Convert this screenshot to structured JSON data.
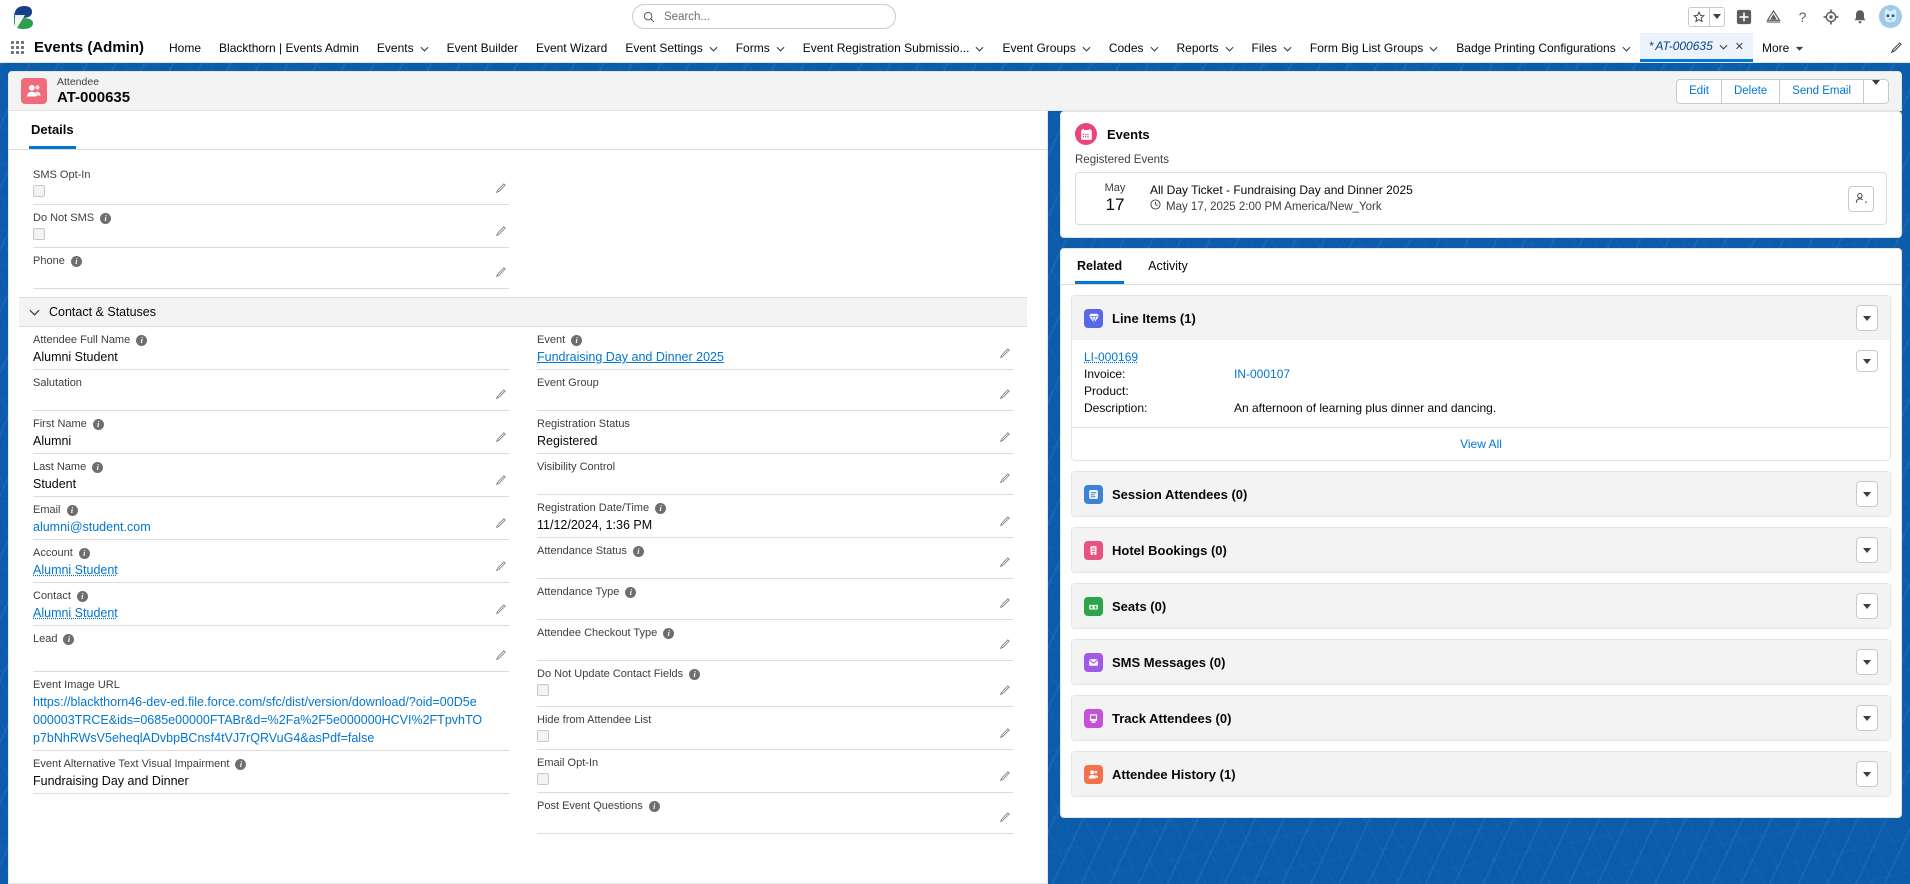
{
  "global_header": {
    "search_placeholder": "Search...",
    "search_value": "",
    "icons": [
      "favorites-star-icon",
      "favorites-caret-icon",
      "add-icon",
      "learning-icon",
      "help-icon",
      "setup-gear-icon",
      "notifications-bell-icon",
      "user-avatar"
    ]
  },
  "app_nav": {
    "app_name": "Events (Admin)",
    "items": [
      {
        "label": "Home",
        "caret": false,
        "active": false
      },
      {
        "label": "Blackthorn | Events Admin",
        "caret": false,
        "active": false
      },
      {
        "label": "Events",
        "caret": true,
        "active": false
      },
      {
        "label": "Event Builder",
        "caret": false,
        "active": false
      },
      {
        "label": "Event Wizard",
        "caret": false,
        "active": false
      },
      {
        "label": "Event Settings",
        "caret": true,
        "active": false
      },
      {
        "label": "Forms",
        "caret": true,
        "active": false
      },
      {
        "label": "Event Registration Submissio...",
        "caret": true,
        "active": false
      },
      {
        "label": "Event Groups",
        "caret": true,
        "active": false
      },
      {
        "label": "Codes",
        "caret": true,
        "active": false
      },
      {
        "label": "Reports",
        "caret": true,
        "active": false
      },
      {
        "label": "Files",
        "caret": true,
        "active": false
      },
      {
        "label": "Form Big List Groups",
        "caret": true,
        "active": false
      },
      {
        "label": "Badge Printing Configurations",
        "caret": true,
        "active": false
      }
    ],
    "active_tab": {
      "prefix": "*",
      "label": "AT-000635",
      "close": "✕"
    },
    "more_label": "More"
  },
  "record_header": {
    "object_label": "Attendee",
    "record_name": "AT-000635",
    "buttons": [
      "Edit",
      "Delete",
      "Send Email"
    ]
  },
  "details": {
    "tab_label": "Details",
    "top_fields": [
      {
        "label": "SMS Opt-In",
        "info": false,
        "type": "checkbox",
        "value": "",
        "editable": true
      },
      {
        "label": "Do Not SMS",
        "info": true,
        "type": "checkbox",
        "value": "",
        "editable": true
      },
      {
        "label": "Phone",
        "info": true,
        "type": "text",
        "value": "",
        "editable": true
      }
    ],
    "section_title": "Contact & Statuses",
    "left_fields": [
      {
        "label": "Attendee Full Name",
        "info": true,
        "type": "text",
        "value": "Alumni Student",
        "editable": false
      },
      {
        "label": "Salutation",
        "info": false,
        "type": "text",
        "value": "",
        "editable": true
      },
      {
        "label": "First Name",
        "info": true,
        "type": "text",
        "value": "Alumni",
        "editable": true
      },
      {
        "label": "Last Name",
        "info": true,
        "type": "text",
        "value": "Student",
        "editable": true
      },
      {
        "label": "Email",
        "info": true,
        "type": "link-plain",
        "value": "alumni@student.com",
        "editable": true
      },
      {
        "label": "Account",
        "info": true,
        "type": "link-dotted",
        "value": "Alumni Student",
        "editable": true
      },
      {
        "label": "Contact",
        "info": true,
        "type": "link-dotted",
        "value": "Alumni Student",
        "editable": true
      },
      {
        "label": "Lead",
        "info": true,
        "type": "text",
        "value": "",
        "editable": true
      },
      {
        "label": "Event Image URL",
        "info": false,
        "type": "link-url",
        "value": "https://blackthorn46-dev-ed.file.force.com/sfc/dist/version/download/?oid=00D5e000003TRCE&ids=0685e00000FTABr&d=%2Fa%2F5e000000HCVI%2FTpvhTOp7bNhRWsV5eheqlADvbpBCnsf4tVJ7rQRVuG4&asPdf=false",
        "editable": false
      },
      {
        "label": "Event Alternative Text Visual Impairment",
        "info": true,
        "type": "text",
        "value": "Fundraising Day and Dinner",
        "editable": false
      }
    ],
    "right_fields": [
      {
        "label": "Event",
        "info": true,
        "type": "link-dotted",
        "value": "Fundraising Day and Dinner 2025",
        "editable": true
      },
      {
        "label": "Event Group",
        "info": false,
        "type": "text",
        "value": "",
        "editable": true
      },
      {
        "label": "Registration Status",
        "info": false,
        "type": "text",
        "value": "Registered",
        "editable": true
      },
      {
        "label": "Visibility Control",
        "info": false,
        "type": "text",
        "value": "",
        "editable": true
      },
      {
        "label": "Registration Date/Time",
        "info": true,
        "type": "text",
        "value": "11/12/2024, 1:36 PM",
        "editable": true
      },
      {
        "label": "Attendance Status",
        "info": true,
        "type": "text",
        "value": "",
        "editable": true
      },
      {
        "label": "Attendance Type",
        "info": true,
        "type": "text",
        "value": "",
        "editable": true
      },
      {
        "label": "Attendee Checkout Type",
        "info": true,
        "type": "text",
        "value": "",
        "editable": true
      },
      {
        "label": "Do Not Update Contact Fields",
        "info": true,
        "type": "checkbox",
        "value": "",
        "editable": true
      },
      {
        "label": "Hide from Attendee List",
        "info": false,
        "type": "checkbox",
        "value": "",
        "editable": true
      },
      {
        "label": "Email Opt-In",
        "info": false,
        "type": "checkbox",
        "value": "",
        "editable": true
      },
      {
        "label": "Post Event Questions",
        "info": true,
        "type": "text",
        "value": "",
        "editable": true
      }
    ]
  },
  "events_card": {
    "title": "Events",
    "sub_label": "Registered Events",
    "registered": [
      {
        "month": "May",
        "day": "17",
        "title": "All Day Ticket - Fundraising Day and Dinner 2025",
        "when": "May 17, 2025 2:00 PM America/New_York"
      }
    ]
  },
  "related_panel": {
    "tabs": [
      {
        "label": "Related",
        "active": true
      },
      {
        "label": "Activity",
        "active": false
      }
    ],
    "line_items": {
      "title": "Line Items (1)",
      "icon_color": "#5867e8",
      "records": [
        {
          "name": "LI-000169",
          "rows": [
            {
              "key": "Invoice:",
              "value": "IN-000107",
              "is_link": true
            },
            {
              "key": "Product:",
              "value": "",
              "is_link": false
            },
            {
              "key": "Description:",
              "value": "An afternoon of learning plus dinner and dancing.",
              "is_link": false
            }
          ]
        }
      ],
      "view_all": "View All"
    },
    "lists": [
      {
        "title": "Session Attendees (0)",
        "icon_color": "#3b82d8",
        "icon": "session-attendees-icon"
      },
      {
        "title": "Hotel Bookings (0)",
        "icon_color": "#e8527f",
        "icon": "hotel-bookings-icon"
      },
      {
        "title": "Seats (0)",
        "icon_color": "#2ca54a",
        "icon": "seats-icon"
      },
      {
        "title": "SMS Messages (0)",
        "icon_color": "#a05ae8",
        "icon": "sms-messages-icon"
      },
      {
        "title": "Track Attendees (0)",
        "icon_color": "#c451d8",
        "icon": "track-attendees-icon"
      },
      {
        "title": "Attendee History (1)",
        "icon_color": "#f2714d",
        "icon": "attendee-history-icon"
      }
    ]
  }
}
